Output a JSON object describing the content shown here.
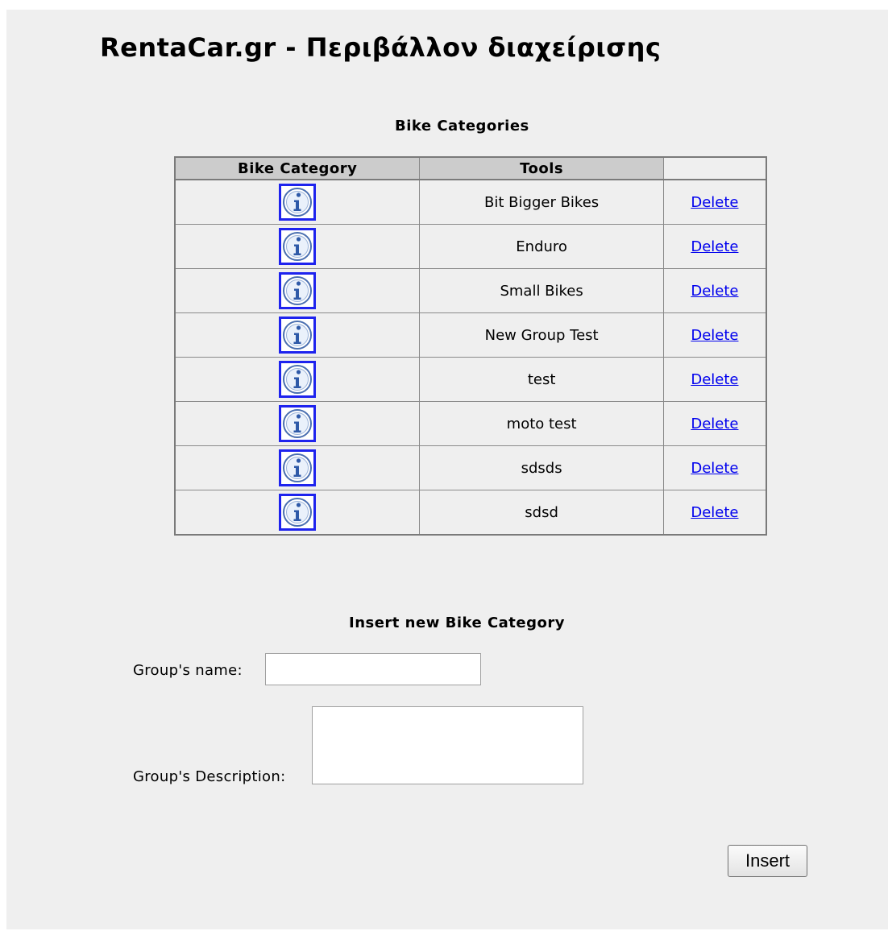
{
  "app": {
    "title": "RentaCar.gr - Περιβάλλον διαχείρισης"
  },
  "list": {
    "title": "Bike Categories",
    "headers": [
      "Bike Category",
      "Tools",
      ""
    ],
    "action_label": "Delete",
    "rows": [
      {
        "name": "Bit Bigger Bikes"
      },
      {
        "name": "Enduro"
      },
      {
        "name": "Small Bikes"
      },
      {
        "name": "New Group Test"
      },
      {
        "name": "test"
      },
      {
        "name": "moto test"
      },
      {
        "name": "sdsds"
      },
      {
        "name": "sdsd"
      }
    ]
  },
  "form": {
    "title": "Insert new Bike Category",
    "name_label": "Group's name:",
    "name_value": "",
    "description_label": "Group's Description:",
    "description_value": "",
    "submit_label": "Insert"
  },
  "icons": {
    "info": "info-icon"
  },
  "colors": {
    "background": "#efefef",
    "header_bg": "#cccccc",
    "link": "#0000ee",
    "icon_border": "#1e23ee"
  }
}
